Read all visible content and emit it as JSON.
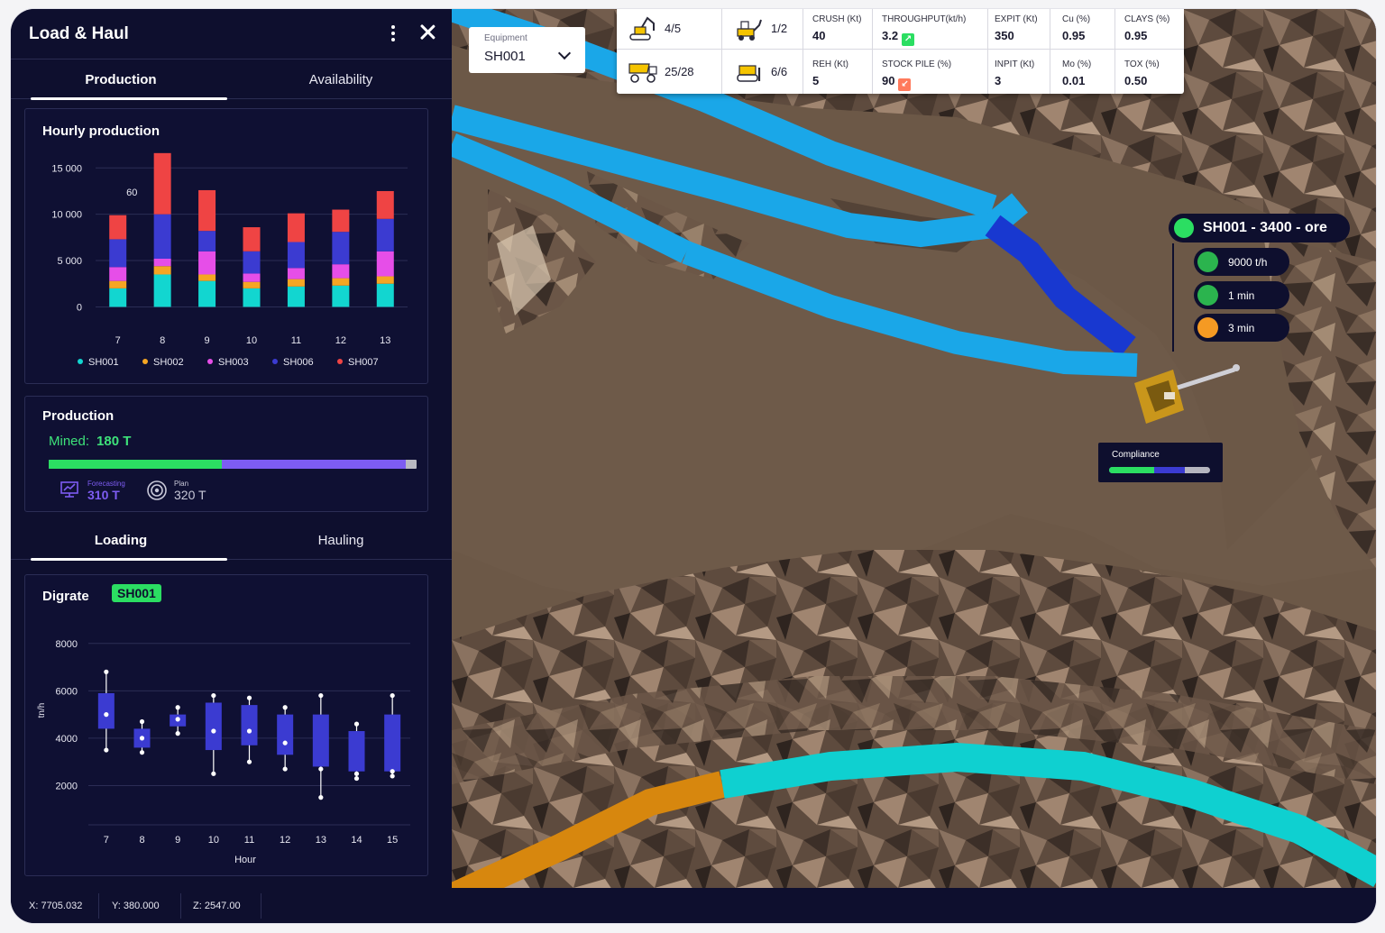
{
  "panel": {
    "title": "Load & Haul",
    "tabs": [
      "Production",
      "Availability"
    ],
    "active_tab": "Production"
  },
  "hourly": {
    "title": "Hourly production",
    "annotation": "60"
  },
  "production": {
    "title": "Production",
    "mined_label": "Mined:",
    "mined_value": "180 T",
    "forecasting_label": "Forecasting",
    "forecasting_value": "310 T",
    "plan_label": "Plan",
    "plan_value": "320 T",
    "progress": {
      "mined_fraction": 0.47,
      "forecast_fraction": 0.97
    }
  },
  "subtabs": [
    "Loading",
    "Hauling"
  ],
  "digrate": {
    "title": "Digrate",
    "badge": "SH001"
  },
  "coords": {
    "x": "X: 7705.032",
    "y": "Y: 380.000",
    "z": "Z: 2547.00"
  },
  "map": {
    "equipment_label": "Equipment",
    "equipment_value": "SH001",
    "counts": [
      {
        "icon": "excavator-icon",
        "value": "4/5"
      },
      {
        "icon": "loader-icon",
        "value": "1/2"
      },
      {
        "icon": "haul-truck-icon",
        "value": "25/28"
      },
      {
        "icon": "dozer-icon",
        "value": "6/6"
      }
    ],
    "stats": [
      {
        "label": "CRUSH (Kt)",
        "value": "40"
      },
      {
        "label": "THROUGHPUT(kt/h)",
        "value": "3.2",
        "trend": "up"
      },
      {
        "label": "EXPIT (Kt)",
        "value": "350"
      },
      {
        "label": "Cu (%)",
        "value": "0.95"
      },
      {
        "label": "CLAYS (%)",
        "value": "0.95"
      },
      {
        "label": "REH (Kt)",
        "value": "5"
      },
      {
        "label": "STOCK PILE (%)",
        "value": "90",
        "trend": "down"
      },
      {
        "label": "INPIT (Kt)",
        "value": "3"
      },
      {
        "label": "Mo (%)",
        "value": "0.01"
      },
      {
        "label": "TOX (%)",
        "value": "0.50"
      }
    ],
    "tooltip": {
      "title": "SH001 - 3400 - ore",
      "rate": "9000 t/h",
      "load_time": "1 min",
      "wait_time": "3 min"
    },
    "compliance": {
      "label": "Compliance",
      "green_fraction": 0.45,
      "blue_fraction": 0.75
    }
  },
  "colors": {
    "SH001": "#12d6d0",
    "SH002": "#f5a623",
    "SH003": "#e64ee8",
    "SH006": "#3b3bd1",
    "SH007": "#ef4444",
    "accent_green": "#2bde62",
    "accent_purple": "#7d5cf2",
    "panel_bg": "#0e0f2e"
  },
  "chart_data": [
    {
      "type": "bar",
      "stacked": true,
      "title": "Hourly production",
      "categories": [
        "7",
        "8",
        "9",
        "10",
        "11",
        "12",
        "13"
      ],
      "y_ticks": [
        "15 000",
        "10 000",
        "5 000",
        "0"
      ],
      "ylim": [
        -2000,
        16000
      ],
      "grid": true,
      "legend_position": "bottom",
      "series": [
        {
          "name": "SH001",
          "values": [
            2000,
            3500,
            2800,
            2000,
            2200,
            2300,
            2500
          ]
        },
        {
          "name": "SH002",
          "values": [
            800,
            900,
            700,
            700,
            800,
            800,
            800
          ]
        },
        {
          "name": "SH003",
          "values": [
            1500,
            800,
            2500,
            900,
            1200,
            1500,
            2700
          ]
        },
        {
          "name": "SH006",
          "values": [
            3000,
            4800,
            2200,
            2400,
            2800,
            3500,
            3500
          ]
        },
        {
          "name": "SH007",
          "values": [
            2600,
            6600,
            4400,
            2600,
            3100,
            2400,
            3000
          ]
        }
      ],
      "annotations": [
        {
          "category": "8",
          "text": "60"
        }
      ]
    },
    {
      "type": "box",
      "title": "Digrate",
      "xlabel": "Hour",
      "ylabel": "tn/h",
      "categories": [
        "7",
        "8",
        "9",
        "10",
        "11",
        "12",
        "13",
        "14",
        "15"
      ],
      "y_ticks": [
        "8000",
        "6000",
        "4000",
        "2000"
      ],
      "ylim": [
        800,
        8600
      ],
      "grid": true,
      "boxes": [
        {
          "min": 3500,
          "q1": 4400,
          "median": 5000,
          "q3": 5900,
          "max": 6800
        },
        {
          "min": 3400,
          "q1": 3600,
          "median": 4000,
          "q3": 4400,
          "max": 4700
        },
        {
          "min": 4200,
          "q1": 4500,
          "median": 4800,
          "q3": 5000,
          "max": 5300
        },
        {
          "min": 2500,
          "q1": 3500,
          "median": 4300,
          "q3": 5500,
          "max": 5800
        },
        {
          "min": 3000,
          "q1": 3700,
          "median": 4300,
          "q3": 5400,
          "max": 5700
        },
        {
          "min": 2700,
          "q1": 3300,
          "median": 3800,
          "q3": 5000,
          "max": 5300
        },
        {
          "min": 1500,
          "q1": 2800,
          "median": 2700,
          "q3": 5000,
          "max": 5800
        },
        {
          "min": 2300,
          "q1": 2600,
          "median": 2500,
          "q3": 4300,
          "max": 4600
        },
        {
          "min": 2400,
          "q1": 2600,
          "median": 2600,
          "q3": 5000,
          "max": 5800
        }
      ]
    }
  ]
}
